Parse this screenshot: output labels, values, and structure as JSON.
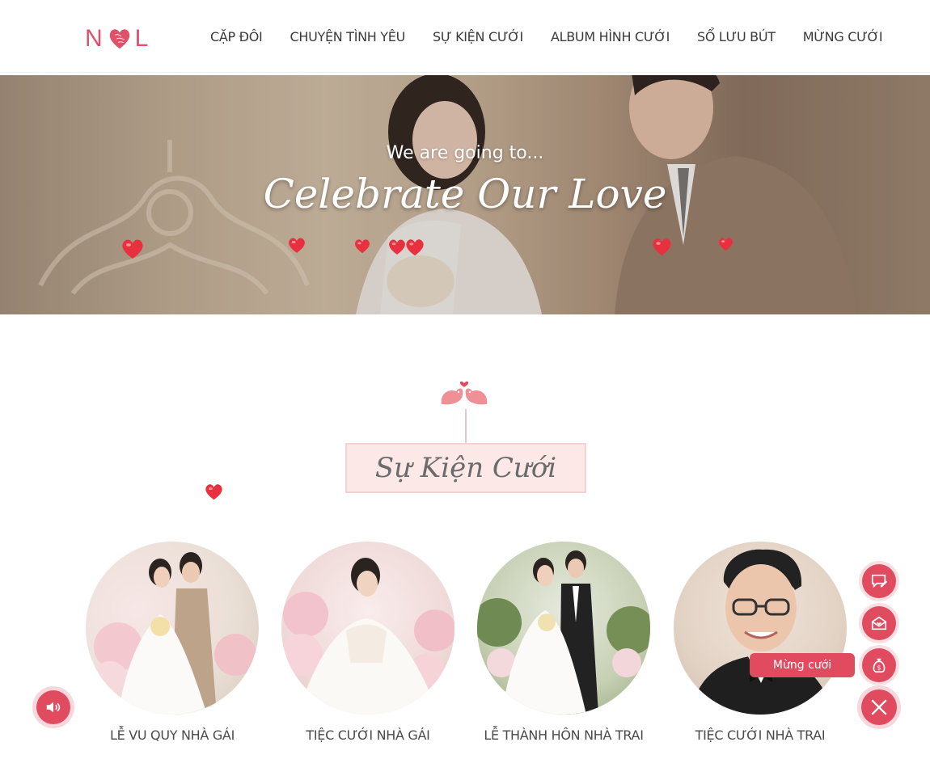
{
  "logo": {
    "left": "N",
    "right": "L"
  },
  "nav": {
    "items": [
      {
        "label": "CẶP ĐÔI"
      },
      {
        "label": "CHUYỆN TÌNH YÊU"
      },
      {
        "label": "SỰ KIỆN CƯỚI"
      },
      {
        "label": "ALBUM HÌNH CƯỚI"
      },
      {
        "label": "SỔ LƯU BÚT"
      },
      {
        "label": "MỪNG CƯỚI"
      }
    ]
  },
  "hero": {
    "subtitle": "We are going to...",
    "title": "Celebrate Our Love"
  },
  "section": {
    "title": "Sự Kiện Cưới"
  },
  "events": [
    {
      "label": "LỄ VU QUY NHÀ GÁI"
    },
    {
      "label": "TIỆC CƯỚI NHÀ GÁI"
    },
    {
      "label": "LỄ THÀNH HÔN NHÀ TRAI"
    },
    {
      "label": "TIỆC CƯỚI NHÀ TRAI"
    }
  ],
  "floating": {
    "tooltip": "Mừng cưới",
    "icons": [
      "chat-edit-icon",
      "envelope-heart-icon",
      "money-bag-icon",
      "close-icon",
      "speaker-icon"
    ]
  },
  "colors": {
    "accent": "#e04b5f",
    "section_bg": "#fde8e8"
  }
}
